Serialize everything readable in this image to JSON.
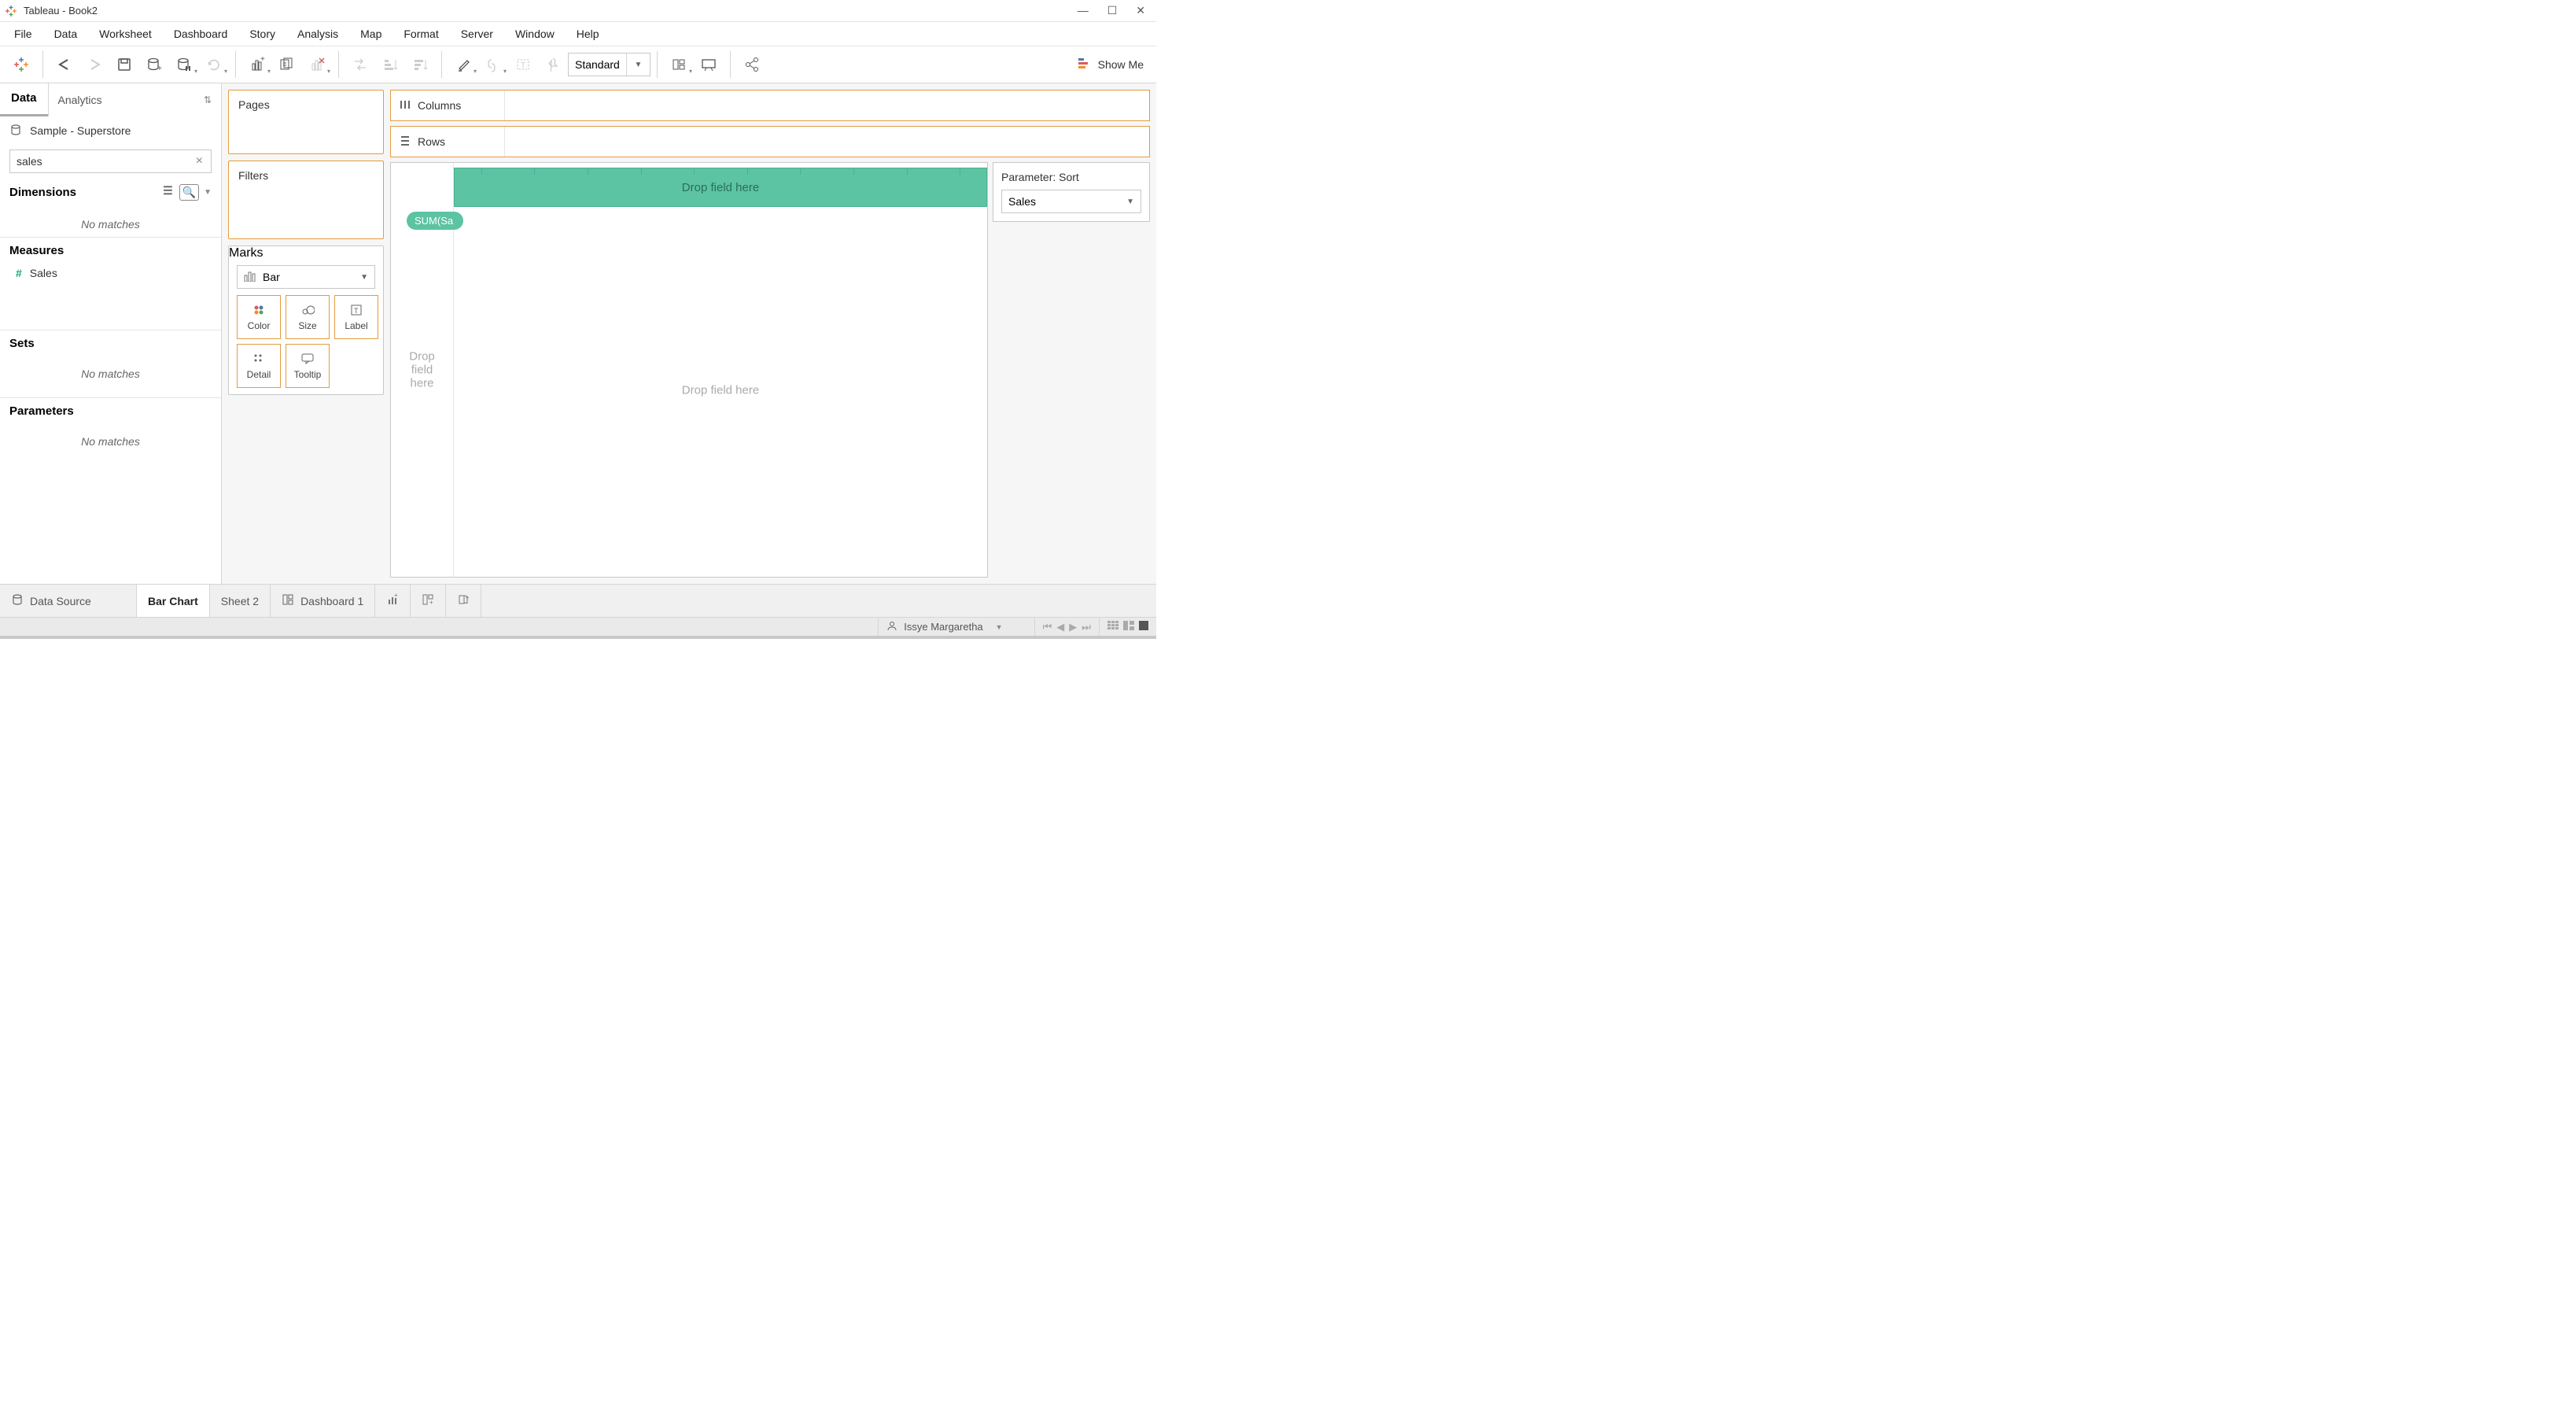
{
  "titlebar": {
    "app": "Tableau",
    "document": "Book2"
  },
  "menubar": [
    "File",
    "Data",
    "Worksheet",
    "Dashboard",
    "Story",
    "Analysis",
    "Map",
    "Format",
    "Server",
    "Window",
    "Help"
  ],
  "toolbar": {
    "fit_mode": "Standard",
    "showme_label": "Show Me"
  },
  "left_panel": {
    "tabs": {
      "data": "Data",
      "analytics": "Analytics"
    },
    "datasource": "Sample - Superstore",
    "search_value": "sales",
    "dimensions_label": "Dimensions",
    "measures_label": "Measures",
    "sets_label": "Sets",
    "parameters_label": "Parameters",
    "no_matches": "No matches",
    "measures": [
      {
        "name": "Sales"
      }
    ]
  },
  "cards": {
    "pages": "Pages",
    "filters": "Filters",
    "marks": "Marks",
    "mark_type": "Bar",
    "cells": {
      "color": "Color",
      "size": "Size",
      "label": "Label",
      "detail": "Detail",
      "tooltip": "Tooltip"
    }
  },
  "shelves": {
    "columns": "Columns",
    "rows": "Rows"
  },
  "canvas": {
    "drop_field": "Drop field here",
    "drop_stack": "Drop\nfield\nhere",
    "pill": "SUM(Sa"
  },
  "parameter_panel": {
    "label": "Parameter: Sort",
    "value": "Sales"
  },
  "bottom_tabs": {
    "data_source": "Data Source",
    "tabs": [
      "Bar Chart",
      "Sheet 2",
      "Dashboard 1"
    ]
  },
  "statusbar": {
    "user": "Issye Margaretha"
  }
}
